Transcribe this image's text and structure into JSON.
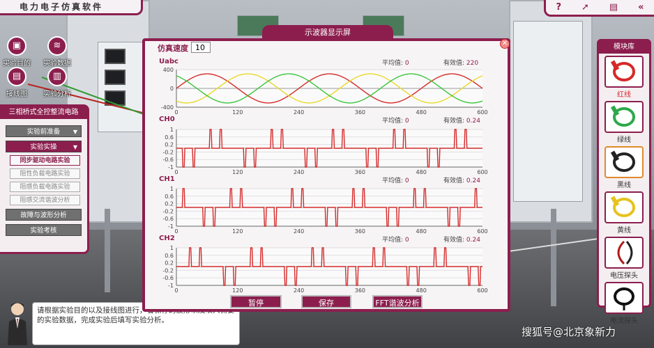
{
  "app_title": "电力电子仿真软件",
  "top_icons": [
    "?",
    "➚",
    "▤",
    "«"
  ],
  "quick_buttons": [
    {
      "label": "实验目的",
      "icon": "cube-icon"
    },
    {
      "label": "实验数据",
      "icon": "layers-icon"
    },
    {
      "label": "接线图",
      "icon": "document-icon"
    },
    {
      "label": "实验分析",
      "icon": "bar-chart-icon"
    }
  ],
  "left_panel": {
    "title": "三相桥式全控整流电路",
    "prep": "实验前准备",
    "operate": "实验实操",
    "sub_items": [
      "同步驱动电路实验",
      "阻性负载电路实验",
      "阻感负载电路实验",
      "阻感交流谐波分析"
    ],
    "fault": "故障与波形分析",
    "exam": "实验考核"
  },
  "hint_text": "请根据实验目的以及接线图进行，看保存的波形以及填入需要的实验数据，完成实验后填写实验分析。",
  "scope": {
    "tab_title": "示波器显示屏",
    "speed_label": "仿真速度",
    "speed_value": "10",
    "avg_label": "平均值:",
    "rms_label": "有效值:",
    "buttons": {
      "pause": "暂停",
      "save": "保存",
      "fft": "FFT谐波分析"
    }
  },
  "module_lib": {
    "title": "模块库",
    "items": [
      {
        "name": "红线",
        "color": "#d62828"
      },
      {
        "name": "绿线",
        "color": "#2ea84a"
      },
      {
        "name": "黑线",
        "color": "#222222"
      },
      {
        "name": "黄线",
        "color": "#e6c21e"
      },
      {
        "name": "电压探头",
        "color": "#b01818"
      },
      {
        "name": "电流探头",
        "color": "#111111"
      }
    ]
  },
  "watermark": "搜狐号@北京象新力",
  "chart_data": [
    {
      "type": "line",
      "title": "Uabc",
      "avg": "0",
      "rms": "220",
      "xlim": [
        0,
        600
      ],
      "xticks": [
        "0",
        "120",
        "240",
        "360",
        "480",
        "600"
      ],
      "ylim": [
        -400,
        400
      ],
      "yticks": [
        "400",
        "0",
        "-400"
      ],
      "series": [
        {
          "color": "#d42a2a",
          "amplitude": 310,
          "period": 240,
          "phase_deg": 0
        },
        {
          "color": "#e8d92a",
          "amplitude": 310,
          "period": 240,
          "phase_deg": -120
        },
        {
          "color": "#39c63a",
          "amplitude": 310,
          "period": 240,
          "phase_deg": 120
        }
      ]
    },
    {
      "type": "line",
      "title": "CH0",
      "avg": "0",
      "rms": "0.24",
      "xlim": [
        0,
        600
      ],
      "xticks": [
        "0",
        "120",
        "240",
        "360",
        "480",
        "600"
      ],
      "ylim": [
        -1,
        1
      ],
      "yticks": [
        "1",
        "0.6",
        "0.2",
        "-0.2",
        "-0.6",
        "-1"
      ],
      "series": [
        {
          "color": "#d42a2a",
          "pulses": [
            [
              14,
              -1
            ],
            [
              34,
              -1
            ],
            [
              67,
              1
            ],
            [
              87,
              1
            ],
            [
              134,
              -1
            ],
            [
              154,
              -1
            ],
            [
              187,
              1
            ],
            [
              207,
              1
            ],
            [
              254,
              -1
            ],
            [
              274,
              -1
            ],
            [
              307,
              1
            ],
            [
              327,
              1
            ],
            [
              374,
              -1
            ],
            [
              394,
              -1
            ],
            [
              427,
              1
            ],
            [
              447,
              1
            ],
            [
              494,
              -1
            ],
            [
              514,
              -1
            ],
            [
              547,
              1
            ],
            [
              567,
              1
            ]
          ]
        }
      ]
    },
    {
      "type": "line",
      "title": "CH1",
      "avg": "0",
      "rms": "0.24",
      "xlim": [
        0,
        600
      ],
      "xticks": [
        "0",
        "120",
        "240",
        "360",
        "480",
        "600"
      ],
      "ylim": [
        -1,
        1
      ],
      "yticks": [
        "1",
        "0.6",
        "0.2",
        "-0.2",
        "-0.6",
        "-1"
      ],
      "series": [
        {
          "color": "#d42a2a",
          "pulses": [
            [
              14,
              1
            ],
            [
              54,
              -1
            ],
            [
              74,
              -1
            ],
            [
              107,
              1
            ],
            [
              127,
              1
            ],
            [
              174,
              -1
            ],
            [
              194,
              -1
            ],
            [
              227,
              1
            ],
            [
              247,
              1
            ],
            [
              294,
              -1
            ],
            [
              314,
              -1
            ],
            [
              347,
              1
            ],
            [
              367,
              1
            ],
            [
              414,
              -1
            ],
            [
              434,
              -1
            ],
            [
              467,
              1
            ],
            [
              487,
              1
            ],
            [
              534,
              -1
            ],
            [
              554,
              -1
            ],
            [
              587,
              1
            ]
          ]
        }
      ]
    },
    {
      "type": "line",
      "title": "CH2",
      "avg": "0",
      "rms": "0.24",
      "xlim": [
        0,
        600
      ],
      "xticks": [
        "0",
        "120",
        "240",
        "360",
        "480",
        "600"
      ],
      "ylim": [
        -1,
        1
      ],
      "yticks": [
        "1",
        "0.6",
        "0.2",
        "-0.2",
        "-0.6",
        "-1"
      ],
      "series": [
        {
          "color": "#d42a2a",
          "pulses": [
            [
              27,
              1
            ],
            [
              47,
              1
            ],
            [
              94,
              -1
            ],
            [
              114,
              -1
            ],
            [
              147,
              1
            ],
            [
              167,
              1
            ],
            [
              214,
              -1
            ],
            [
              234,
              -1
            ],
            [
              267,
              1
            ],
            [
              287,
              1
            ],
            [
              334,
              -1
            ],
            [
              354,
              -1
            ],
            [
              387,
              1
            ],
            [
              407,
              1
            ],
            [
              454,
              -1
            ],
            [
              474,
              -1
            ],
            [
              507,
              1
            ],
            [
              527,
              1
            ],
            [
              574,
              -1
            ],
            [
              594,
              -1
            ]
          ]
        }
      ]
    }
  ]
}
